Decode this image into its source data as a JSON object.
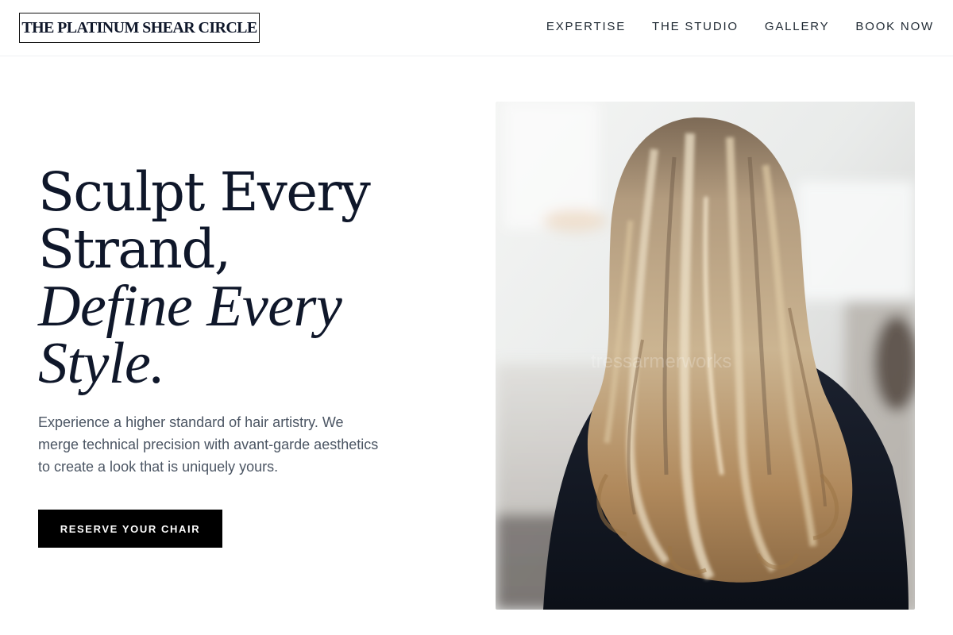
{
  "header": {
    "logo_text": "THE PLATINUM SHEAR CIRCLE",
    "nav": [
      {
        "label": "EXPERTISE"
      },
      {
        "label": "THE STUDIO"
      },
      {
        "label": "GALLERY"
      },
      {
        "label": "BOOK NOW"
      }
    ]
  },
  "hero": {
    "title_line1": "Sculpt Every",
    "title_line2": "Strand,",
    "title_line3": "Define Every",
    "title_line4": "Style.",
    "body": "Experience a higher standard of hair artistry. We merge technical precision with avant-garde aesthetics to create a look that is uniquely yours.",
    "cta_label": "RESERVE YOUR CHAIR"
  },
  "photo": {
    "watermark": "tressarmerworks"
  },
  "colors": {
    "text_dark": "#0f172a",
    "body_text": "#4b5563",
    "button_bg": "#000000",
    "button_text": "#ffffff"
  }
}
